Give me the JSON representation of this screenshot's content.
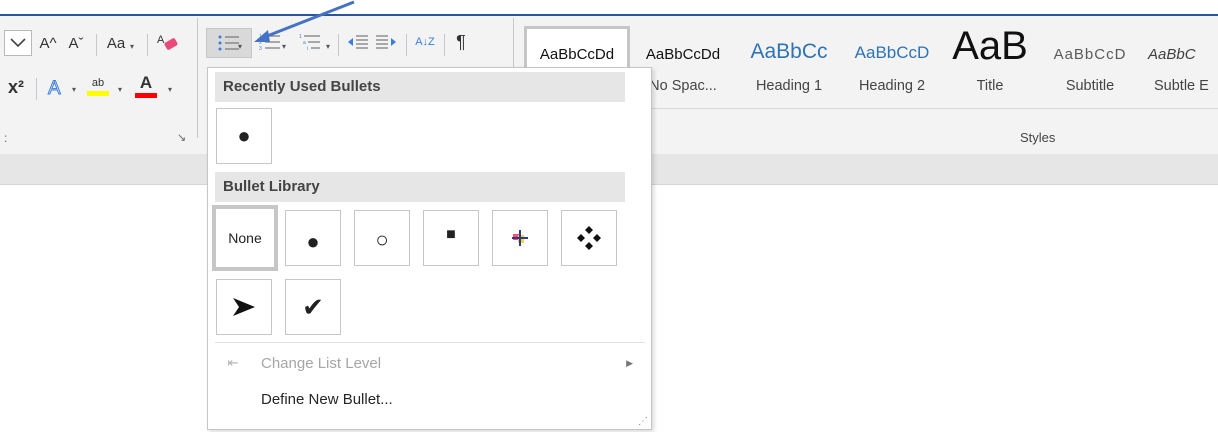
{
  "ribbon": {
    "font_group": {
      "grow_font_icon": "A^",
      "shrink_font_icon": "Aˇ",
      "change_case_label": "Aa",
      "superscript_label": "x²",
      "highlight_label": "ab",
      "font_color_label": "A",
      "highlight_color": "#ffff00",
      "font_color": "#ff0000"
    },
    "paragraph_group": {
      "sort_label": "A↓Z",
      "pilcrow_label": "¶"
    },
    "styles_group": {
      "label": "Styles",
      "tiles": [
        {
          "sample": "AaBbCcDd",
          "name": "",
          "selected": true
        },
        {
          "sample": "AaBbCcDd",
          "name": "No Spac..."
        },
        {
          "sample": "AaBbCc",
          "name": "Heading 1"
        },
        {
          "sample": "AaBbCcD",
          "name": "Heading 2"
        },
        {
          "sample": "AaB",
          "name": "Title"
        },
        {
          "sample": "AaBbCcD",
          "name": "Subtitle"
        },
        {
          "sample": "AaBbC",
          "name": "Subtle E"
        }
      ]
    }
  },
  "bullets_dropdown": {
    "recently_used_header": "Recently Used Bullets",
    "recent_bullets": [
      "●"
    ],
    "library_header": "Bullet Library",
    "library": [
      "None",
      "●",
      "○",
      "■",
      "✚",
      "❖",
      "➤",
      "✔"
    ],
    "change_list_level": "Change List Level",
    "define_new_bullet": "Define New Bullet...",
    "accent_color": "#2b579a"
  }
}
